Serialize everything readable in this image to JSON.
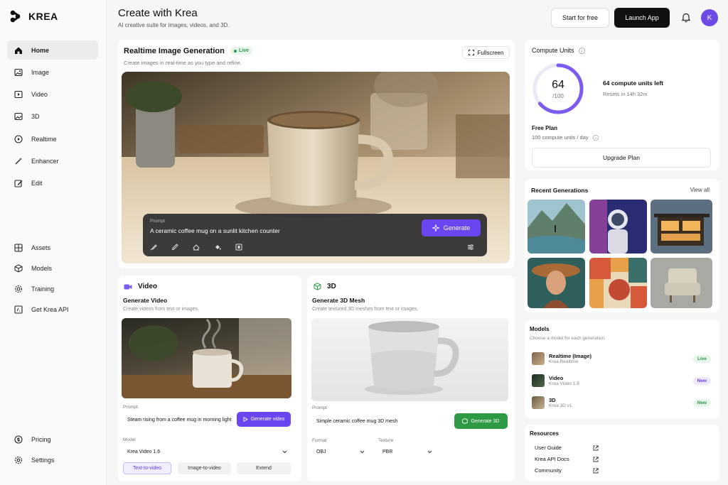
{
  "brand": {
    "name": "KREA"
  },
  "nav": {
    "main": [
      {
        "label": "Home",
        "icon": "home-icon"
      },
      {
        "label": "Image",
        "icon": "image-icon"
      },
      {
        "label": "Video",
        "icon": "video-icon"
      },
      {
        "label": "3D",
        "icon": "cube-icon"
      },
      {
        "label": "Realtime",
        "icon": "play-icon"
      },
      {
        "label": "Enhancer",
        "icon": "wand-icon"
      },
      {
        "label": "Edit",
        "icon": "edit-icon"
      }
    ],
    "secondary": [
      {
        "label": "Assets",
        "icon": "grid-icon"
      },
      {
        "label": "Models",
        "icon": "box-icon"
      },
      {
        "label": "Training",
        "icon": "gear-icon"
      },
      {
        "label": "Get Krea API",
        "icon": "code-icon"
      }
    ],
    "bottom": [
      {
        "label": "Pricing",
        "icon": "dollar-icon"
      },
      {
        "label": "Settings",
        "icon": "settings-icon"
      }
    ]
  },
  "header": {
    "title": "Create with Krea",
    "subtitle": "AI creative suite for images, videos, and 3D.",
    "start_label": "Start for free",
    "launch_label": "Launch App",
    "avatar_letter": "K"
  },
  "realtime": {
    "title": "Realtime Image Generation",
    "live_label": "Live",
    "subtitle": "Create images in real-time as you type and refine.",
    "fullscreen_label": "Fullscreen",
    "prompt_label": "Prompt",
    "prompt_value": "A ceramic coffee mug on a sunlit kitchen counter",
    "generate_label": "Generate"
  },
  "video": {
    "section": "Video",
    "title": "Generate Video",
    "subtitle": "Create videos from text or images.",
    "prompt_label": "Prompt",
    "prompt_value": "Steam rising from a coffee mug in morning light",
    "generate_label": "Generate video",
    "model_label": "Model",
    "model_value": "Krea Video 1.6",
    "modes": [
      "Text-to-video",
      "Image-to-video",
      "Extend"
    ]
  },
  "d3": {
    "section": "3D",
    "title": "Generate 3D Mesh",
    "subtitle": "Create textured 3D meshes from text or images.",
    "prompt_label": "Prompt",
    "prompt_value": "Simple ceramic coffee mug 3D mesh",
    "generate_label": "Generate 3D",
    "format_label": "Format",
    "format_value": "OBJ",
    "texture_label": "Texture",
    "texture_value": "PBR"
  },
  "compute": {
    "title": "Compute Units",
    "value": "64",
    "max": "/100",
    "fraction": 0.64,
    "left_label": "64 compute units left",
    "reset_label": "Resets in 14h 32m",
    "plan": "Free Plan",
    "plan_desc": "100 compute units / day",
    "upgrade_label": "Upgrade Plan"
  },
  "recent": {
    "title": "Recent Generations",
    "view_all": "View all"
  },
  "models": {
    "title": "Models",
    "subtitle": "Choose a model for each generation.",
    "items": [
      {
        "name": "Realtime (Image)",
        "desc": "Krea Realtime",
        "badge": "Live"
      },
      {
        "name": "Video",
        "desc": "Krea Video 1.6",
        "badge": "New"
      },
      {
        "name": "3D",
        "desc": "Krea 3D v1",
        "badge": "New"
      }
    ]
  },
  "resources": {
    "title": "Resources",
    "items": [
      "User Guide",
      "Krea API Docs",
      "Community"
    ]
  },
  "colors": {
    "accent": "#6b45f0",
    "generate3d": "#2e9a44",
    "live_bg": "#e7f6ea",
    "new_bg": "#eee9ff"
  }
}
